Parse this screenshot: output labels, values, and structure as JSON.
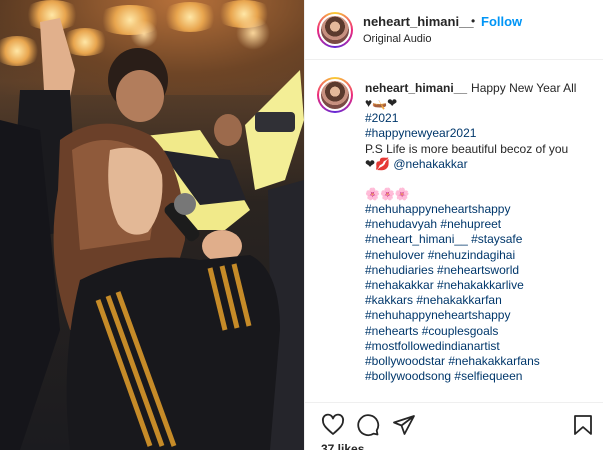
{
  "post": {
    "username": "neheart_himani__",
    "dot": "•",
    "follow_label": "Follow",
    "audio_label": "Original Audio"
  },
  "caption": {
    "author": "neheart_himani__",
    "first_text": "Happy New Year All",
    "line2_emoji": "♥🛶❤",
    "tag_2021": "#2021",
    "tag_hny": "#happynewyear2021",
    "ps_line": "P.S Life is more beautiful becoz of you",
    "mention_emoji": "❤💋",
    "mention": "@nehakakkar",
    "flowers": "🌸🌸🌸",
    "hashtags": [
      "#nehuhappyneheartshappy",
      "#nehudavyah #nehupreet",
      "#neheart_himani__ #staysafe",
      "#nehulover #nehuzindagihai",
      "#nehudiaries #neheartsworld",
      "#nehakakkar #nehakakkarlive",
      "#kakkars #nehakakkarfan",
      "#nehuhappyneheartshappy",
      "#nehearts #couplesgoals",
      "#mostfollowedindianartist",
      "#bollywoodstar #nehakakkarfans",
      "#bollywoodsong #selfiequeen"
    ]
  },
  "footer": {
    "likes": "37 likes"
  },
  "icons": {
    "like": "heart-icon",
    "comment": "comment-icon",
    "share": "share-icon",
    "save": "bookmark-icon"
  }
}
